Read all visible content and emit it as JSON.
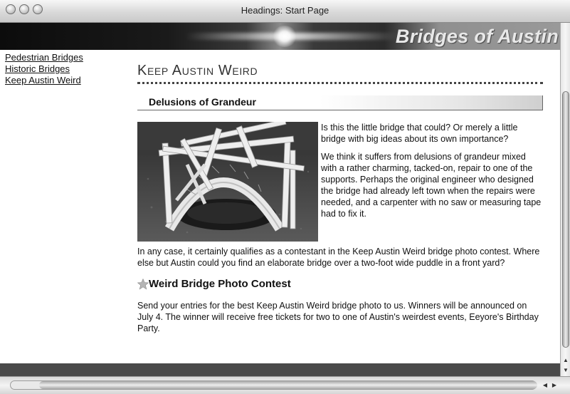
{
  "window": {
    "title": "Headings: Start Page"
  },
  "banner": {
    "site_title": "Bridges of Austin"
  },
  "nav": {
    "links": [
      "Pedestrian Bridges",
      "Historic Bridges",
      "Keep Austin Weird"
    ]
  },
  "main": {
    "heading": "Keep Austin Weird",
    "section_heading": "Delusions of Grandeur",
    "paragraphs": [
      "Is this the little bridge that could? Or merely a little bridge with big ideas about its own importance?",
      "We think it suffers from delusions of grandeur mixed with a rather charming, tacked-on, repair to one of the supports. Perhaps the original engineer who designed the bridge had already left town when the repairs were needed, and a carpenter with no saw or measuring tape had to fix it.",
      "In any case, it certainly qualifies as a contestant in the Keep Austin Weird bridge photo contest. Where else but Austin could you find an elaborate bridge over a two-foot wide puddle in a front yard?"
    ],
    "subheading": "Weird Bridge Photo Contest",
    "contest_text": "Send your entries for the best Keep Austin Weird bridge photo to us. Winners will be announced on July 4. The winner will receive free tickets for two to one of Austin's weirdest events, Eeyore's Birthday Party."
  },
  "icons": {
    "window_buttons": [
      "close-icon",
      "minimize-icon",
      "zoom-icon"
    ],
    "heading_bullet": "star-icon",
    "scroll_up": "arrow-up-icon",
    "scroll_down": "arrow-down-icon",
    "scroll_left": "arrow-left-icon",
    "scroll_right": "arrow-right-icon"
  }
}
